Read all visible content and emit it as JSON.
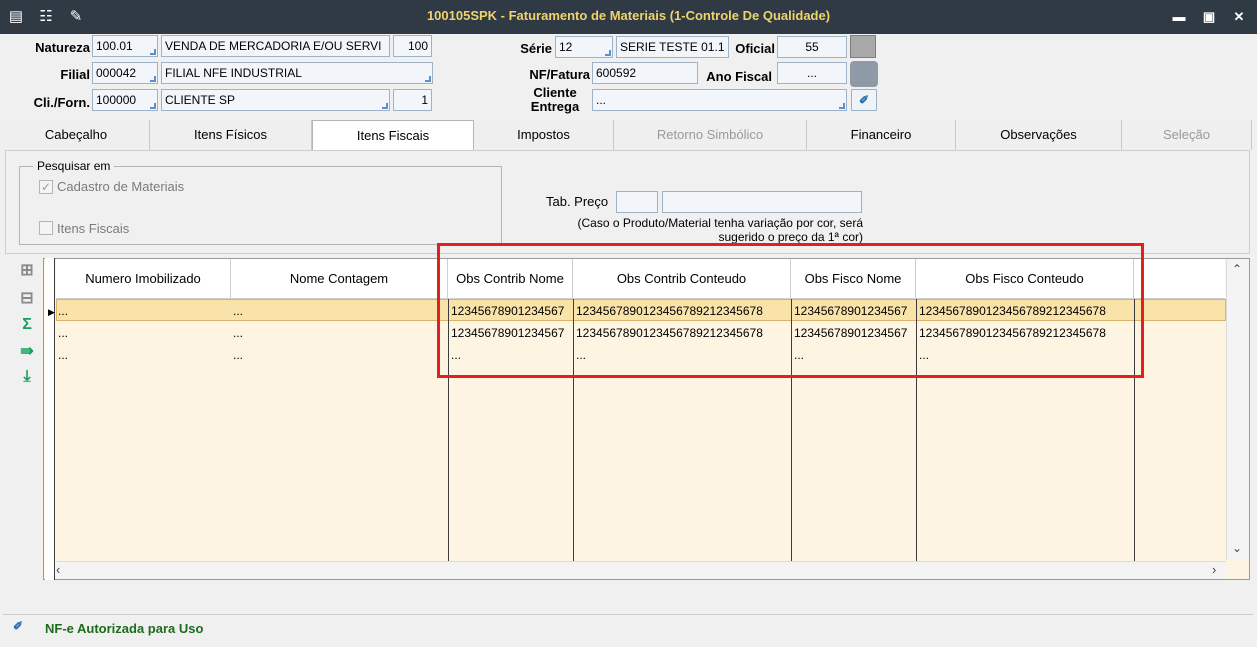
{
  "window": {
    "title": "100105SPK - Faturamento de Materiais (1-Controle De Qualidade)",
    "controls": [
      "▬",
      "▣",
      "✕"
    ]
  },
  "header": {
    "natureza": {
      "label": "Natureza",
      "code": "100.01",
      "desc": "VENDA DE MERCADORIA E/OU SERVI",
      "num": "100"
    },
    "filial": {
      "label": "Filial",
      "code": "000042",
      "desc": "FILIAL NFE INDUSTRIAL"
    },
    "cli": {
      "label": "Cli./Forn.",
      "code": "100000",
      "desc": "CLIENTE SP",
      "num": "1"
    },
    "serie": {
      "label": "Série",
      "code": "12",
      "desc": "SERIE TESTE 01.1"
    },
    "oficial": {
      "label": "Oficial",
      "value": "55"
    },
    "nf": {
      "label": "NF/Fatura",
      "value": "600592"
    },
    "ano": {
      "label": "Ano Fiscal",
      "value": "..."
    },
    "cliente_entrega": {
      "label_line1": "Cliente",
      "label_line2": "Entrega",
      "value": "..."
    }
  },
  "tabs": [
    {
      "label": "Cabeçalho",
      "state": "normal"
    },
    {
      "label": "Itens Físicos",
      "state": "normal"
    },
    {
      "label": "Itens Fiscais",
      "state": "active"
    },
    {
      "label": "Impostos",
      "state": "normal"
    },
    {
      "label": "Retorno Simbólico",
      "state": "disabled"
    },
    {
      "label": "Financeiro",
      "state": "normal"
    },
    {
      "label": "Observações",
      "state": "normal"
    },
    {
      "label": "Seleção",
      "state": "disabled"
    }
  ],
  "search": {
    "group_title": "Pesquisar em",
    "opt1": "Cadastro de Materiais",
    "opt1_checked": "✓",
    "opt2": "Itens Fiscais",
    "tab_preco_label": "Tab. Preço",
    "note_line1": "(Caso o Produto/Material tenha variação por cor, será",
    "note_line2": "sugerido o preço da 1ª cor)"
  },
  "grid": {
    "columns": [
      "Numero Imobilizado",
      "Nome Contagem",
      "Obs Contrib Nome",
      "Obs Contrib Conteudo",
      "Obs Fisco Nome",
      "Obs Fisco Conteudo"
    ],
    "rows": [
      [
        "...",
        "...",
        "12345678901234567",
        "1234567890123456789212345678",
        "12345678901234567",
        "1234567890123456789212345678"
      ],
      [
        "...",
        "...",
        "12345678901234567",
        "1234567890123456789212345678",
        "12345678901234567",
        "1234567890123456789212345678"
      ],
      [
        "...",
        "...",
        "...",
        "...",
        "...",
        "..."
      ]
    ],
    "highlight_color": "#e32020",
    "selected_row_color": "#f9e3a8"
  },
  "side_icons": [
    "add-row-icon",
    "remove-row-icon",
    "sum-icon",
    "export-icon",
    "goto-end-icon"
  ],
  "status": {
    "text": "NF-e Autorizada para Uso",
    "color": "#1d6b1d"
  }
}
